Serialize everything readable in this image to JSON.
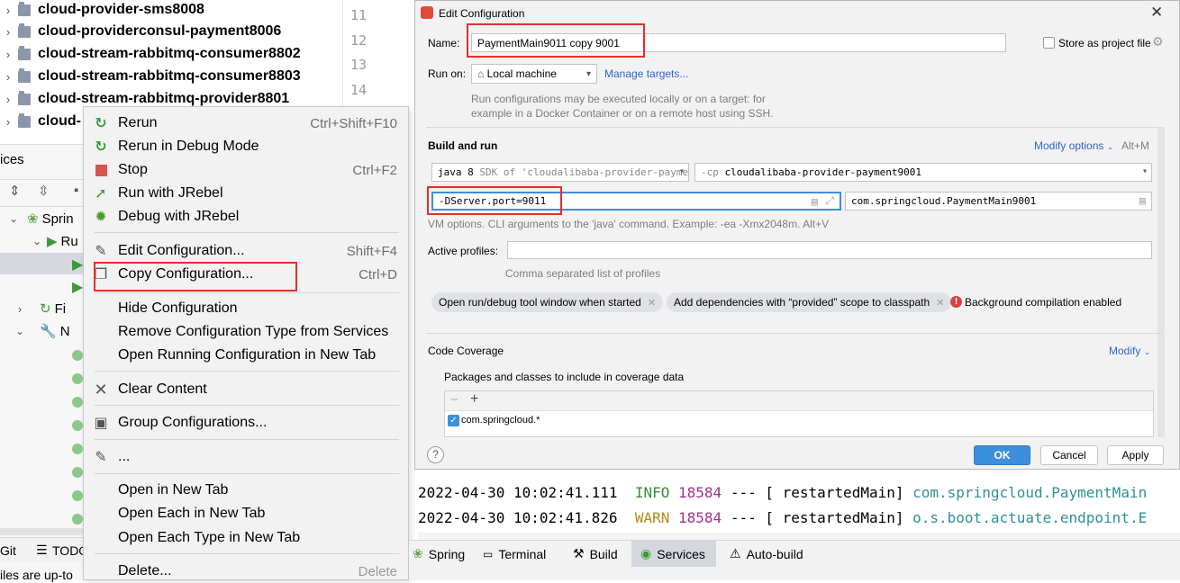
{
  "project_tree": {
    "modules": [
      "cloud-provider-sms8008",
      "cloud-providerconsul-payment8006",
      "cloud-stream-rabbitmq-consumer8802",
      "cloud-stream-rabbitmq-consumer8803",
      "cloud-stream-rabbitmq-provider8801",
      "cloud-"
    ]
  },
  "editor": {
    "line_numbers": [
      "11",
      "12",
      "13",
      "14"
    ]
  },
  "services_panel": {
    "title": "ices",
    "tree": [
      "Sprin",
      "Ru",
      "Fi",
      "N"
    ],
    "bottom_tabs": {
      "git": "Git",
      "todo": "TODO"
    },
    "status": "iles are up-to"
  },
  "context_menu": {
    "items": [
      {
        "label": "Rerun",
        "shortcut": "Ctrl+Shift+F10",
        "icon": "rerun-icon"
      },
      {
        "label": "Rerun in Debug Mode",
        "shortcut": "",
        "icon": "rerun-debug-icon"
      },
      {
        "label": "Stop",
        "shortcut": "Ctrl+F2",
        "icon": "stop-icon"
      },
      {
        "label": "Run with JRebel",
        "shortcut": "",
        "icon": "jrebel-run-icon"
      },
      {
        "label": "Debug with JRebel",
        "shortcut": "",
        "icon": "jrebel-debug-icon"
      },
      {
        "label": "Edit Configuration...",
        "shortcut": "Shift+F4",
        "icon": "edit-icon"
      },
      {
        "label": "Copy Configuration...",
        "shortcut": "Ctrl+D",
        "icon": "copy-icon"
      },
      {
        "label": "Hide Configuration",
        "shortcut": "",
        "icon": ""
      },
      {
        "label": "Remove Configuration Type from Services",
        "shortcut": "",
        "icon": ""
      },
      {
        "label": "Open Running Configuration in New Tab",
        "shortcut": "",
        "icon": ""
      },
      {
        "label": "Clear Content",
        "shortcut": "",
        "icon": "close-icon"
      },
      {
        "label": "Group Configurations...",
        "shortcut": "",
        "icon": "group-icon"
      },
      {
        "label": "...",
        "shortcut": "",
        "icon": "pencil-icon"
      },
      {
        "label": "Open in New Tab",
        "shortcut": "",
        "icon": ""
      },
      {
        "label": "Open Each in New Tab",
        "shortcut": "",
        "icon": ""
      },
      {
        "label": "Open Each Type in New Tab",
        "shortcut": "",
        "icon": ""
      },
      {
        "label": "Delete...",
        "shortcut": "Delete",
        "icon": ""
      }
    ]
  },
  "dialog": {
    "title": "Edit Configuration",
    "name_label": "Name:",
    "name_value": "PaymentMain9011 copy 9001",
    "store_label": "Store as project file",
    "run_on_label": "Run on:",
    "run_on_value": "Local machine",
    "manage_targets": "Manage targets...",
    "run_on_hint_1": "Run configurations may be executed locally or on a target: for",
    "run_on_hint_2": "example in a Docker Container or on a remote host using SSH.",
    "build_run_label": "Build and run",
    "modify_options": "Modify options",
    "modify_shortcut": "Alt+M",
    "jdk_name": "java 8",
    "jdk_hint": "SDK of 'cloudalibaba-provider-payme",
    "cp_prefix": "-cp",
    "cp_value": "cloudalibaba-provider-payment9001",
    "vm_options": "-DServer.port=9011",
    "main_class": "com.springcloud.PaymentMain9001",
    "vm_hint": "VM options. CLI arguments to the 'java' command. Example: -ea -Xmx2048m. Alt+V",
    "active_profiles_label": "Active profiles:",
    "profiles_hint": "Comma separated list of profiles",
    "chip_1": "Open run/debug tool window when started",
    "chip_2": "Add dependencies with “provided” scope to classpath",
    "bg_compile": "Background compilation enabled",
    "coverage_label": "Code Coverage",
    "modify_link": "Modify",
    "packages_label": "Packages and classes to include in coverage data",
    "package_item": "com.springcloud.*",
    "help": "?",
    "ok": "OK",
    "cancel": "Cancel",
    "apply": "Apply"
  },
  "console": {
    "lines": [
      {
        "ts": "2022-04-30 10:02:41.111",
        "level": "INFO",
        "pid": "18584",
        "sep": "---",
        "thread": "[  restartedMain]",
        "logger": "com.springcloud.PaymentMain"
      },
      {
        "ts": "2022-04-30 10:02:41.826",
        "level": "WARN",
        "pid": "18584",
        "sep": "---",
        "thread": "[  restartedMain]",
        "logger": "o.s.boot.actuate.endpoint.E"
      }
    ]
  },
  "bottom_toolbar": {
    "tabs": [
      "Spring",
      "Terminal",
      "Build",
      "Services",
      "Auto-build"
    ]
  }
}
